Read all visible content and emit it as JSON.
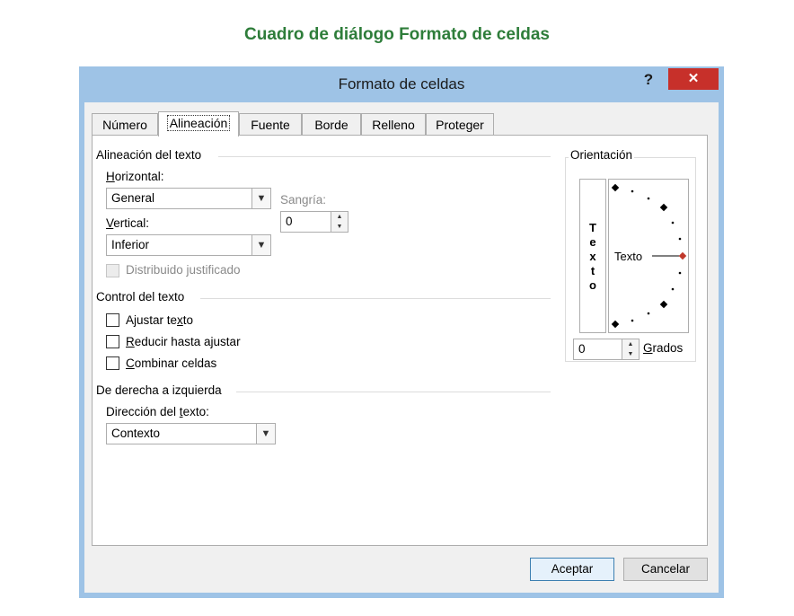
{
  "caption": "Cuadro de diálogo Formato de celdas",
  "dialog": {
    "title": "Formato de celdas",
    "help_label": "?",
    "close_label": "✕"
  },
  "tabs": [
    {
      "label": "Número"
    },
    {
      "label": "Alineación",
      "active": true
    },
    {
      "label": "Fuente"
    },
    {
      "label": "Borde"
    },
    {
      "label": "Relleno"
    },
    {
      "label": "Proteger"
    }
  ],
  "text_alignment": {
    "heading": "Alineación del texto",
    "horizontal": {
      "label_u": "H",
      "label_rest": "orizontal:",
      "value": "General"
    },
    "vertical": {
      "label_u": "V",
      "label_rest": "ertical:",
      "value": "Inferior"
    },
    "indent": {
      "label": "Sangría:",
      "value": "0"
    },
    "distributed": {
      "label": "Distribuido justificado",
      "checked": false,
      "enabled": false
    }
  },
  "text_control": {
    "heading": "Control del texto",
    "wrap": {
      "pre": "Ajustar te",
      "u": "x",
      "post": "to",
      "checked": false
    },
    "shrink": {
      "pre": "",
      "u": "R",
      "post": "educir hasta ajustar",
      "checked": false
    },
    "merge": {
      "pre": "",
      "u": "C",
      "post": "ombinar celdas",
      "checked": false
    }
  },
  "rtl": {
    "heading": "De derecha a izquierda",
    "direction": {
      "pre": "Dirección del ",
      "u": "t",
      "post": "exto:",
      "value": "Contexto"
    }
  },
  "orientation": {
    "heading": "Orientación",
    "vertical_text": [
      "T",
      "e",
      "x",
      "t",
      "o"
    ],
    "dial_label": "Texto",
    "degrees_value": "0",
    "degrees_label_u": "G",
    "degrees_label_rest": "rados"
  },
  "buttons": {
    "ok": "Aceptar",
    "cancel": "Cancelar"
  },
  "colors": {
    "caption": "#2e7d3a",
    "frame": "#9ec3e6",
    "close": "#c7302a",
    "dial_marker": "#c0392b"
  }
}
